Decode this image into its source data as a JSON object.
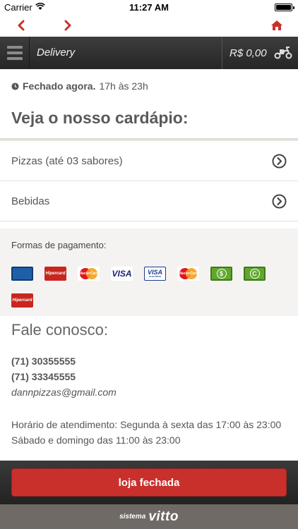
{
  "status_bar": {
    "carrier": "Carrier",
    "time": "11:27 AM"
  },
  "icons": {
    "nav_back": "chevron-left-icon",
    "nav_forward": "chevron-right-icon",
    "home": "home-icon",
    "menu": "hamburger-icon",
    "cart": "scooter-icon",
    "clock": "clock-icon",
    "chevron": "circle-chevron-right-icon"
  },
  "colors": {
    "accent_red": "#c9302c",
    "header_dark": "#2e2e2e",
    "pay_green": "#62a730"
  },
  "header": {
    "title": "Delivery",
    "cart_total": "R$ 0,00"
  },
  "store": {
    "status": "Fechado agora.",
    "hours": "17h às 23h"
  },
  "menu": {
    "heading": "Veja o nosso cardápio:",
    "categories": [
      {
        "label": "Pizzas (até 03 sabores)"
      },
      {
        "label": "Bebidas"
      }
    ]
  },
  "payment": {
    "title": "Formas de pagamento:",
    "methods": [
      {
        "name": "American Express",
        "text": ""
      },
      {
        "name": "Hipercard",
        "text": "Hipercard"
      },
      {
        "name": "MasterCard",
        "text": "MasterCard"
      },
      {
        "name": "Visa",
        "text": "VISA"
      },
      {
        "name": "Visa Electron",
        "text": "VISA",
        "sub": "ELECTRON"
      },
      {
        "name": "MasterCard",
        "text": "MasterCard"
      },
      {
        "name": "Dinheiro",
        "text": "$"
      },
      {
        "name": "Cheque",
        "text": "C"
      },
      {
        "name": "Hipercard",
        "text": "Hipercard"
      }
    ]
  },
  "contact": {
    "title": "Fale conosco:",
    "phones": [
      "(71) 30355555",
      "(71) 33345555"
    ],
    "email": "dannpizzas@gmail.com",
    "hours_line_1": "Horário de atendimento: Segunda à sexta das 17:00 às 23:00",
    "hours_line_2": "Sábado e domingo das 11:00 às 23:00"
  },
  "footer": {
    "button_label": "loja fechada"
  },
  "brand": {
    "prefix": "sistema",
    "name": "vitto"
  }
}
